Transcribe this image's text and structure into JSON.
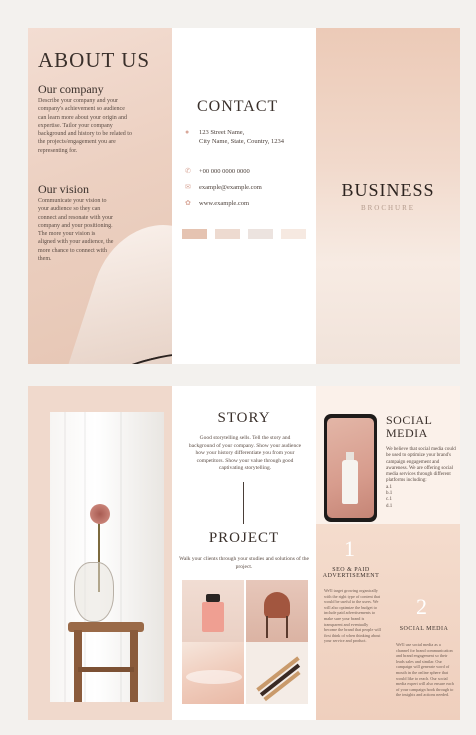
{
  "about": {
    "title": "ABOUT US",
    "company_heading": "Our company",
    "company_text": "Describe your company and your company's achievement so audience can learn more about your origin and expertise. Tailor your company background and history to be related to the projects/engagement you are representing for.",
    "vision_heading": "Our vision",
    "vision_text": "Communicate your vision to your audience so they can connect and resonate with your company and your positioning. The more your vision is aligned with your audience, the more chance to connect with them."
  },
  "contact": {
    "title": "CONTACT",
    "address_line1": "123 Street Name,",
    "address_line2": "City Name, State, Country, 1234",
    "phone": "+00 000 0000 0000",
    "email": "example@example.com",
    "website": "www.example.com",
    "swatches": [
      "#e5c3b1",
      "#eddad0",
      "#ece3df",
      "#f6e9e1"
    ]
  },
  "cover": {
    "title": "BUSINESS",
    "subtitle": "BROCHURE"
  },
  "story": {
    "title": "STORY",
    "text": "Good storytelling sells. Tell the story and background of your company. Show your audience how your history differentiate you from your competitors. Show your value through good captivating storytelling."
  },
  "project": {
    "title": "PROJECT",
    "text": "Walk your clients through your studies and solutions of the project."
  },
  "social": {
    "title_line1": "SOCIAL",
    "title_line2": "MEDIA",
    "text": "We believe that social media could be used to optimize your brand's campaign engagement and awareness. We are offering social media services through different platforms including:",
    "list": [
      "a.1",
      "b.1",
      "c.1",
      "d.1"
    ],
    "service1": {
      "number": "1",
      "title_line1": "SEO & PAID",
      "title_line2": "ADVERTISEMENT",
      "text": "We'll target growing organically with the right type of content that would be useful to the users. We will also optimize the budget to include paid advertisements to make sure your brand is transparent and eventually become the brand that people will first think of when thinking about your service and product."
    },
    "service2": {
      "number": "2",
      "title": "SOCIAL MEDIA",
      "text": "We'll use social media as a channel for brand communication and brand engagement so their leads sales and similar. Our campaign will generate word of mouth in the online sphere that would like to reach. Our social media expert will also ensure each of your campaign hook through to the insights and actions needed."
    }
  },
  "icons": {
    "address": "location-pin-icon",
    "phone": "phone-icon",
    "email": "envelope-icon",
    "website": "globe-icon"
  }
}
